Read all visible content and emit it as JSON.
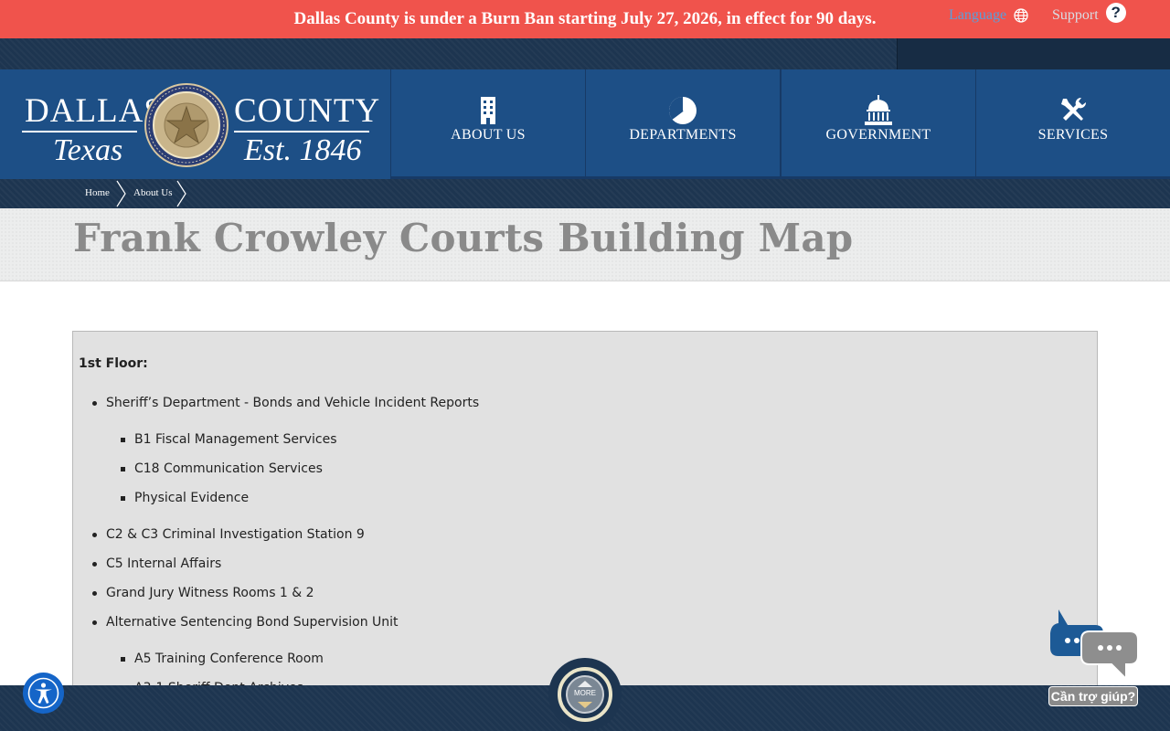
{
  "alert": {
    "text": "Dallas County is under a Burn Ban starting July 27, 2026, in effect for 90 days."
  },
  "utility": {
    "language_label": "Language",
    "support_label": "Support",
    "support_glyph": "?"
  },
  "logo": {
    "line1_left": "DALLAS",
    "line1_right": "COUNTY",
    "line2_left": "Texas",
    "line2_right": "Est. 1846"
  },
  "nav": [
    {
      "label": "ABOUT US",
      "icon": "building-icon"
    },
    {
      "label": "DEPARTMENTS",
      "icon": "pie-chart-icon"
    },
    {
      "label": "GOVERNMENT",
      "icon": "capitol-icon"
    },
    {
      "label": "SERVICES",
      "icon": "tools-icon"
    }
  ],
  "breadcrumb": [
    "Home",
    "About Us"
  ],
  "page": {
    "title": "Frank Crowley Courts Building Map"
  },
  "content": {
    "floor_heading": "1st Floor:",
    "items": [
      {
        "text": "Sheriff’s Department - Bonds and Vehicle Incident Reports",
        "level": 1
      },
      {
        "text": "B1 Fiscal Management Services",
        "level": 2
      },
      {
        "text": "C18 Communication Services",
        "level": 2
      },
      {
        "text": "Physical Evidence",
        "level": 2
      },
      {
        "text": "C2 & C3 Criminal Investigation Station 9",
        "level": 1
      },
      {
        "text": "C5 Internal Affairs",
        "level": 1
      },
      {
        "text": "Grand Jury Witness Rooms 1 & 2",
        "level": 1
      },
      {
        "text": "Alternative Sentencing Bond Supervision Unit",
        "level": 1
      },
      {
        "text": "A5 Training Conference Room",
        "level": 2
      },
      {
        "text": "A3-1 Sheriff Dept Archives",
        "level": 2
      }
    ]
  },
  "more_button": {
    "label": "MORE"
  },
  "chat": {
    "label": "Cần trợ giúp?"
  }
}
